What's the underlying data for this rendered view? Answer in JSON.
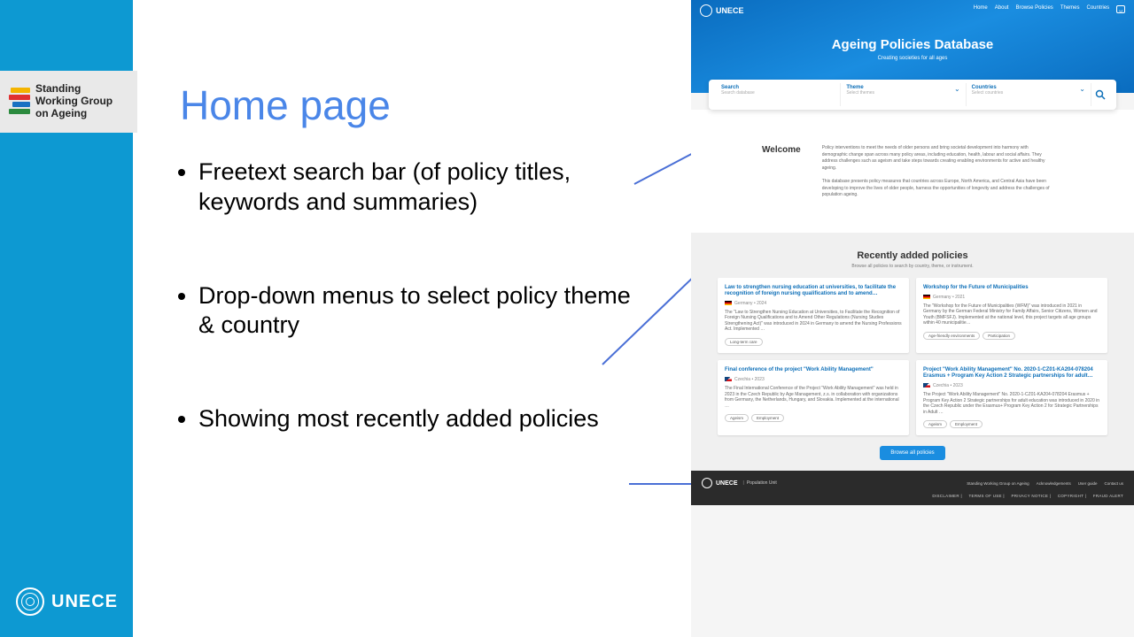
{
  "sidebar_logo": {
    "line1": "Standing",
    "line2": "Working Group",
    "line3": "on Ageing"
  },
  "unece_logo_text": "UNECE",
  "headline": "Home page",
  "bullets": [
    "Freetext search bar (of policy titles, keywords and summaries)",
    "Drop-down menus to select policy theme & country",
    "Showing most recently added policies"
  ],
  "mock": {
    "brand": "UNECE",
    "nav": [
      "Home",
      "About",
      "Browse Policies",
      "Themes",
      "Countries"
    ],
    "hero_title": "Ageing Policies Database",
    "hero_sub": "Creating societies for all ages",
    "search": {
      "s_label": "Search",
      "s_ph": "Search database",
      "t_label": "Theme",
      "t_ph": "Select themes",
      "c_label": "Countries",
      "c_ph": "Select countries"
    },
    "welcome_h": "Welcome",
    "welcome_p1": "Policy interventions to meet the needs of older persons and bring societal development into harmony with demographic change span across many policy areas, including education, health, labour and social affairs. They address challenges such as ageism and take steps towards creating enabling environments for active and healthy ageing.",
    "welcome_p2": "This database presents policy measures that countries across Europe, North America, and Central Asia have been developing to improve the lives of older people, harness the opportunities of longevity and address the challenges of population ageing.",
    "recent_h": "Recently added policies",
    "recent_sub": "Browse all policies to search by country, theme, or instrument.",
    "cards": [
      {
        "title": "Law to strengthen nursing education at universities, to facilitate the recognition of foreign nursing qualifications and to amend…",
        "country": "Germany",
        "year": "2024",
        "flag": "de",
        "desc": "The \"Law to Strengthen Nursing Education at Universities, to Facilitate the Recognition of Foreign Nursing Qualifications and to Amend Other Regulations (Nursing Studies Strengthening Act)\" was introduced in 2024 in Germany to amend the Nursing Professions Act. Implemented …",
        "tags": [
          "Long-term care"
        ]
      },
      {
        "title": "Workshop for the Future of Municipalities",
        "country": "Germany",
        "year": "2021",
        "flag": "de",
        "desc": "The \"Workshop for the Future of Municipalities (WFM)\" was introduced in 2021 in Germany by the German Federal Ministry for Family Affairs, Senior Citizens, Women and Youth (BMFSFJ). Implemented at the national level, this project targets all age groups within 40 municipalitie…",
        "tags": [
          "Age-friendly environments",
          "Participation"
        ]
      },
      {
        "title": "Final conference of the project \"Work Ability Management\"",
        "country": "Czechia",
        "year": "2023",
        "flag": "cz",
        "desc": "The Final International Conference of the Project \"Work Ability Management\" was held in 2023 in the Czech Republic by Age Management, z.s. in collaboration with organizations from Germany, the Netherlands, Hungary, and Slovakia. Implemented at the international …",
        "tags": [
          "Ageism",
          "Employment"
        ]
      },
      {
        "title": "Project \"Work Ability Management\" No. 2020-1-CZ01-KA204-078204 Erasmus + Program Key Action 2 Strategic partnerships for adult…",
        "country": "Czechia",
        "year": "2023",
        "flag": "cz",
        "desc": "The Project \"Work Ability Management\" No. 2020-1-CZ01-KA204-078204 Erasmus + Program Key Action 2 Strategic partnerships for adult education was introduced in 2020 in the Czech Republic under the Erasmus+ Program Key Action 2 for Strategic Partnerships in Adult …",
        "tags": [
          "Ageism",
          "Employment"
        ]
      }
    ],
    "browse_btn": "Browse all policies",
    "footer": {
      "unit": "Population Unit",
      "links1": [
        "Standing Working Group on Ageing",
        "Acknowledgements",
        "User guide",
        "Contact us"
      ],
      "links2": [
        "DISCLAIMER",
        "TERMS OF USE",
        "PRIVACY NOTICE",
        "COPYRIGHT",
        "FRAUD ALERT"
      ]
    }
  }
}
